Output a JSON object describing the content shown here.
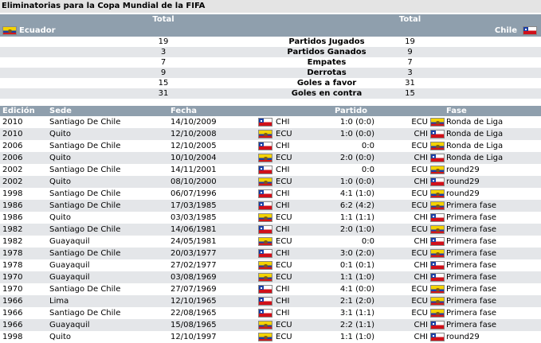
{
  "title": "Eliminatorias para la Copa Mundial de la FIFA",
  "summary": {
    "total_left": "Total",
    "total_right": "Total",
    "team_left": "Ecuador",
    "team_right": "Chile",
    "rows": [
      {
        "left": "19",
        "label": "Partidos Jugados",
        "right": "19"
      },
      {
        "left": "3",
        "label": "Partidos Ganados",
        "right": "9"
      },
      {
        "left": "7",
        "label": "Empates",
        "right": "7"
      },
      {
        "left": "9",
        "label": "Derrotas",
        "right": "3"
      },
      {
        "left": "15",
        "label": "Goles a favor",
        "right": "31"
      },
      {
        "left": "31",
        "label": "Goles en contra",
        "right": "15"
      }
    ]
  },
  "matches_header": {
    "edicion": "Edición",
    "sede": "Sede",
    "fecha": "Fecha",
    "partido": "Partido",
    "fase": "Fase"
  },
  "matches": [
    {
      "edicion": "2010",
      "sede": "Santiago De Chile",
      "fecha": "14/10/2009",
      "home": "CHI",
      "score": "1:0 (0:0)",
      "away": "ECU",
      "fase": "Ronda de Liga"
    },
    {
      "edicion": "2010",
      "sede": "Quito",
      "fecha": "12/10/2008",
      "home": "ECU",
      "score": "1:0 (0:0)",
      "away": "CHI",
      "fase": "Ronda de Liga"
    },
    {
      "edicion": "2006",
      "sede": "Santiago De Chile",
      "fecha": "12/10/2005",
      "home": "CHI",
      "score": "0:0",
      "away": "ECU",
      "fase": "Ronda de Liga"
    },
    {
      "edicion": "2006",
      "sede": "Quito",
      "fecha": "10/10/2004",
      "home": "ECU",
      "score": "2:0 (0:0)",
      "away": "CHI",
      "fase": "Ronda de Liga"
    },
    {
      "edicion": "2002",
      "sede": "Santiago De Chile",
      "fecha": "14/11/2001",
      "home": "CHI",
      "score": "0:0",
      "away": "ECU",
      "fase": "round29"
    },
    {
      "edicion": "2002",
      "sede": "Quito",
      "fecha": "08/10/2000",
      "home": "ECU",
      "score": "1:0 (0:0)",
      "away": "CHI",
      "fase": "round29"
    },
    {
      "edicion": "1998",
      "sede": "Santiago De Chile",
      "fecha": "06/07/1996",
      "home": "CHI",
      "score": "4:1 (1:0)",
      "away": "ECU",
      "fase": "round29"
    },
    {
      "edicion": "1986",
      "sede": "Santiago De Chile",
      "fecha": "17/03/1985",
      "home": "CHI",
      "score": "6:2 (4:2)",
      "away": "ECU",
      "fase": "Primera fase"
    },
    {
      "edicion": "1986",
      "sede": "Quito",
      "fecha": "03/03/1985",
      "home": "ECU",
      "score": "1:1 (1:1)",
      "away": "CHI",
      "fase": "Primera fase"
    },
    {
      "edicion": "1982",
      "sede": "Santiago De Chile",
      "fecha": "14/06/1981",
      "home": "CHI",
      "score": "2:0 (1:0)",
      "away": "ECU",
      "fase": "Primera fase"
    },
    {
      "edicion": "1982",
      "sede": "Guayaquil",
      "fecha": "24/05/1981",
      "home": "ECU",
      "score": "0:0",
      "away": "CHI",
      "fase": "Primera fase"
    },
    {
      "edicion": "1978",
      "sede": "Santiago De Chile",
      "fecha": "20/03/1977",
      "home": "CHI",
      "score": "3:0 (2:0)",
      "away": "ECU",
      "fase": "Primera fase"
    },
    {
      "edicion": "1978",
      "sede": "Guayaquil",
      "fecha": "27/02/1977",
      "home": "ECU",
      "score": "0:1 (0:1)",
      "away": "CHI",
      "fase": "Primera fase"
    },
    {
      "edicion": "1970",
      "sede": "Guayaquil",
      "fecha": "03/08/1969",
      "home": "ECU",
      "score": "1:1 (1:0)",
      "away": "CHI",
      "fase": "Primera fase"
    },
    {
      "edicion": "1970",
      "sede": "Santiago De Chile",
      "fecha": "27/07/1969",
      "home": "CHI",
      "score": "4:1 (0:0)",
      "away": "ECU",
      "fase": "Primera fase"
    },
    {
      "edicion": "1966",
      "sede": "Lima",
      "fecha": "12/10/1965",
      "home": "CHI",
      "score": "2:1 (2:0)",
      "away": "ECU",
      "fase": "Primera fase"
    },
    {
      "edicion": "1966",
      "sede": "Santiago De Chile",
      "fecha": "22/08/1965",
      "home": "CHI",
      "score": "3:1 (1:1)",
      "away": "ECU",
      "fase": "Primera fase"
    },
    {
      "edicion": "1966",
      "sede": "Guayaquil",
      "fecha": "15/08/1965",
      "home": "ECU",
      "score": "2:2 (1:1)",
      "away": "CHI",
      "fase": "Primera fase"
    },
    {
      "edicion": "1998",
      "sede": "Quito",
      "fecha": "12/10/1997",
      "home": "ECU",
      "score": "1:1 (1:0)",
      "away": "CHI",
      "fase": "round29"
    }
  ]
}
